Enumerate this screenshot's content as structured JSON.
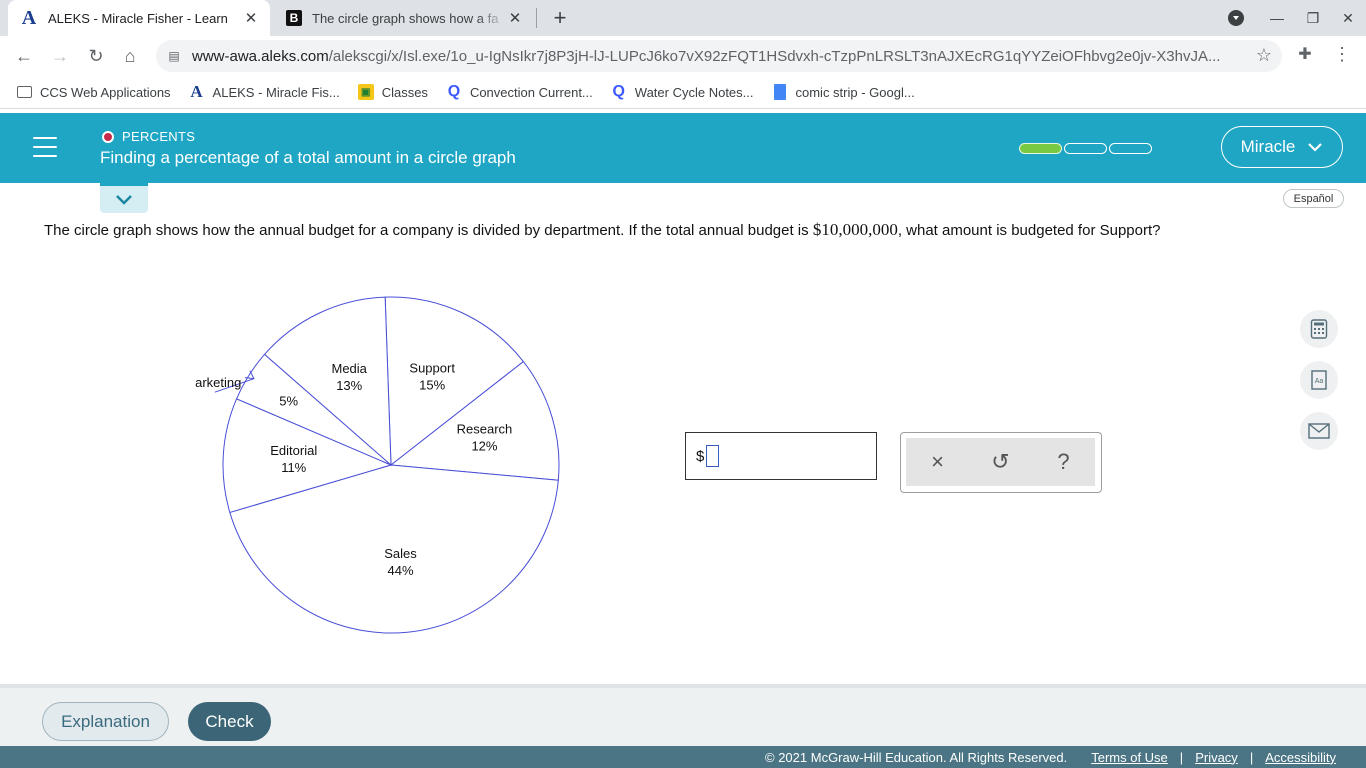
{
  "browser": {
    "tabs": [
      {
        "title": "ALEKS - Miracle Fisher - Learn",
        "favicon": "aleks-icon"
      },
      {
        "title": "The circle graph shows how a fa",
        "favicon": "b-icon"
      }
    ],
    "url_host": "www-awa.aleks.com",
    "url_path": "/alekscgi/x/Isl.exe/1o_u-IgNsIkr7j8P3jH-lJ-LUPcJ6ko7vX92zFQT1HSdvxh-cTzpPnLRSLT3nAJXEcRG1qYYZeiOFhbvg2e0jv-X3hvJA...",
    "bookmarks": [
      {
        "label": "CCS Web Applications",
        "icon": "folder-icon"
      },
      {
        "label": "ALEKS - Miracle Fis...",
        "icon": "aleks-icon"
      },
      {
        "label": "Classes",
        "icon": "classes-icon"
      },
      {
        "label": "Convection Current...",
        "icon": "quizlet-icon"
      },
      {
        "label": "Water Cycle Notes...",
        "icon": "quizlet-icon"
      },
      {
        "label": "comic strip - Googl...",
        "icon": "docs-icon"
      }
    ]
  },
  "header": {
    "topic": "PERCENTS",
    "title": "Finding a percentage of a total amount in a circle graph",
    "progress_fraction": 0.33,
    "user": "Miracle",
    "accent": "#1fa6c4"
  },
  "espanol": "Español",
  "question": {
    "part1": "The circle graph shows how the annual budget for a company is divided by department. If the total annual budget is ",
    "amount": "$10,000,000",
    "part2": ", what amount is budgeted for Support?"
  },
  "chart_data": {
    "type": "pie",
    "categories": [
      "Support",
      "Research",
      "Sales",
      "Editorial",
      "Marketing",
      "Media"
    ],
    "values": [
      15,
      12,
      44,
      11,
      5,
      13
    ],
    "labels": [
      "15%",
      "12%",
      "44%",
      "11%",
      "5%",
      "13%"
    ],
    "stroke_color": "#4a4fd6"
  },
  "answer": {
    "prefix": "$",
    "value": ""
  },
  "tools": {
    "clear": "×",
    "undo": "↺",
    "help": "?"
  },
  "footer": {
    "explanation": "Explanation",
    "check": "Check",
    "copyright": "© 2021 McGraw-Hill Education. All Rights Reserved.",
    "terms": "Terms of Use",
    "privacy": "Privacy",
    "accessibility": "Accessibility",
    "separator": "|"
  }
}
